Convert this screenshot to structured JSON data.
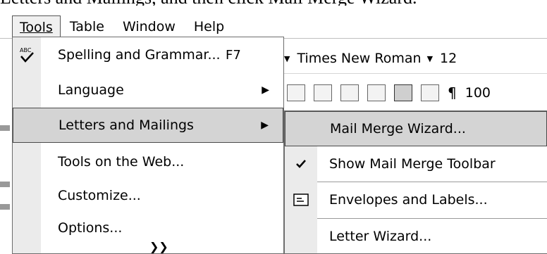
{
  "background": {
    "top_text": "Letters and Mailings, and then click Mail Merge Wizard.",
    "font_name": "Times New Roman",
    "font_size": "12",
    "zoom": "100"
  },
  "menubar": {
    "items": [
      "Tools",
      "Table",
      "Window",
      "Help"
    ]
  },
  "tools_menu": {
    "items": [
      {
        "label": "Spelling and Grammar...",
        "shortcut": "F7",
        "icon": "spelling-icon"
      },
      {
        "label": "Language",
        "submenu": true
      },
      {
        "label": "Letters and Mailings",
        "submenu": true,
        "highlighted": true
      },
      {
        "label": "Tools on the Web..."
      },
      {
        "label": "Customize..."
      },
      {
        "label": "Options..."
      }
    ],
    "expand_icon": "double-chevron-down-icon"
  },
  "letters_submenu": {
    "items": [
      {
        "label": "Mail Merge Wizard...",
        "highlighted": true
      },
      {
        "label": "Show Mail Merge Toolbar",
        "checked": true
      },
      {
        "label": "Envelopes and Labels...",
        "icon": "envelope-icon"
      },
      {
        "label": "Letter Wizard..."
      }
    ]
  },
  "colors": {
    "highlight": "#d4d4d4",
    "gutter": "#ebebeb",
    "border": "#6d6d6d"
  }
}
